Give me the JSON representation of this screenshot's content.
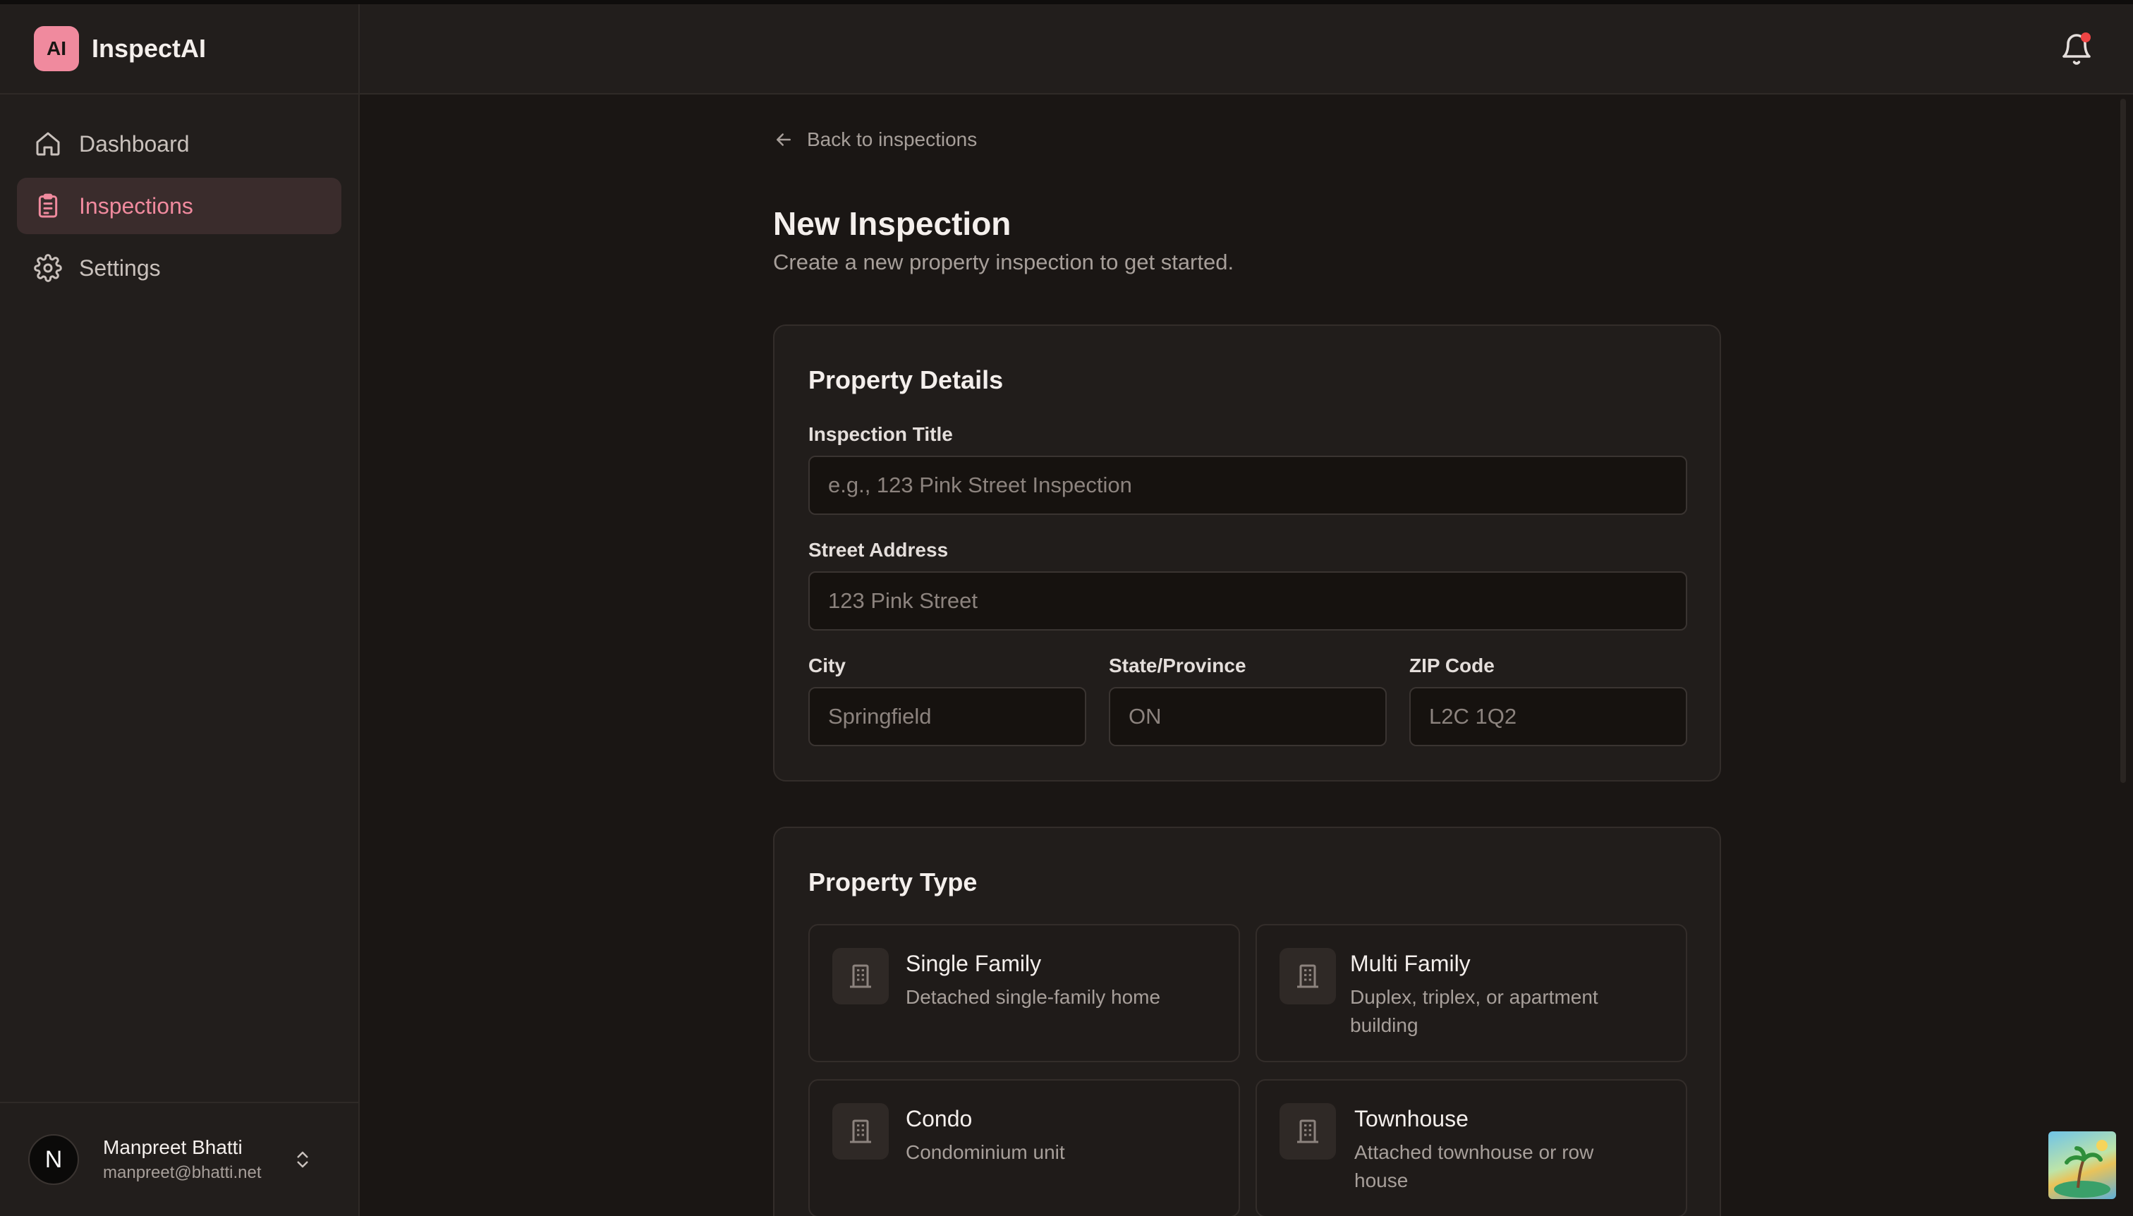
{
  "app": {
    "logo_text": "AI",
    "name": "InspectAI"
  },
  "sidebar": {
    "items": [
      {
        "label": "Dashboard",
        "icon": "home-icon",
        "active": false
      },
      {
        "label": "Inspections",
        "icon": "clipboard-icon",
        "active": true
      },
      {
        "label": "Settings",
        "icon": "gear-icon",
        "active": false
      }
    ]
  },
  "user": {
    "initial": "N",
    "name": "Manpreet Bhatti",
    "email": "manpreet@bhatti.net"
  },
  "header": {
    "notification_icon": "bell-icon",
    "has_unread": true
  },
  "main": {
    "back_label": "Back to inspections",
    "title": "New Inspection",
    "subtitle": "Create a new property inspection to get started."
  },
  "details": {
    "title": "Property Details",
    "inspection_title": {
      "label": "Inspection Title",
      "placeholder": "e.g., 123 Pink Street Inspection",
      "value": ""
    },
    "street": {
      "label": "Street Address",
      "placeholder": "123 Pink Street",
      "value": ""
    },
    "city": {
      "label": "City",
      "placeholder": "Springfield",
      "value": ""
    },
    "state": {
      "label": "State/Province",
      "placeholder": "ON",
      "value": ""
    },
    "zip": {
      "label": "ZIP Code",
      "placeholder": "L2C 1Q2",
      "value": ""
    }
  },
  "property_type": {
    "title": "Property Type",
    "options": [
      {
        "name": "Single Family",
        "description": "Detached single-family home",
        "icon": "building-icon"
      },
      {
        "name": "Multi Family",
        "description": "Duplex, triplex, or apartment building",
        "icon": "building-icon"
      },
      {
        "name": "Condo",
        "description": "Condominium unit",
        "icon": "building-icon"
      },
      {
        "name": "Townhouse",
        "description": "Attached townhouse or row house",
        "icon": "building-icon"
      }
    ]
  },
  "colors": {
    "accent": "#f08a9e",
    "background": "#1a1614",
    "surface": "#211d1b",
    "badge": "#ef4444"
  }
}
